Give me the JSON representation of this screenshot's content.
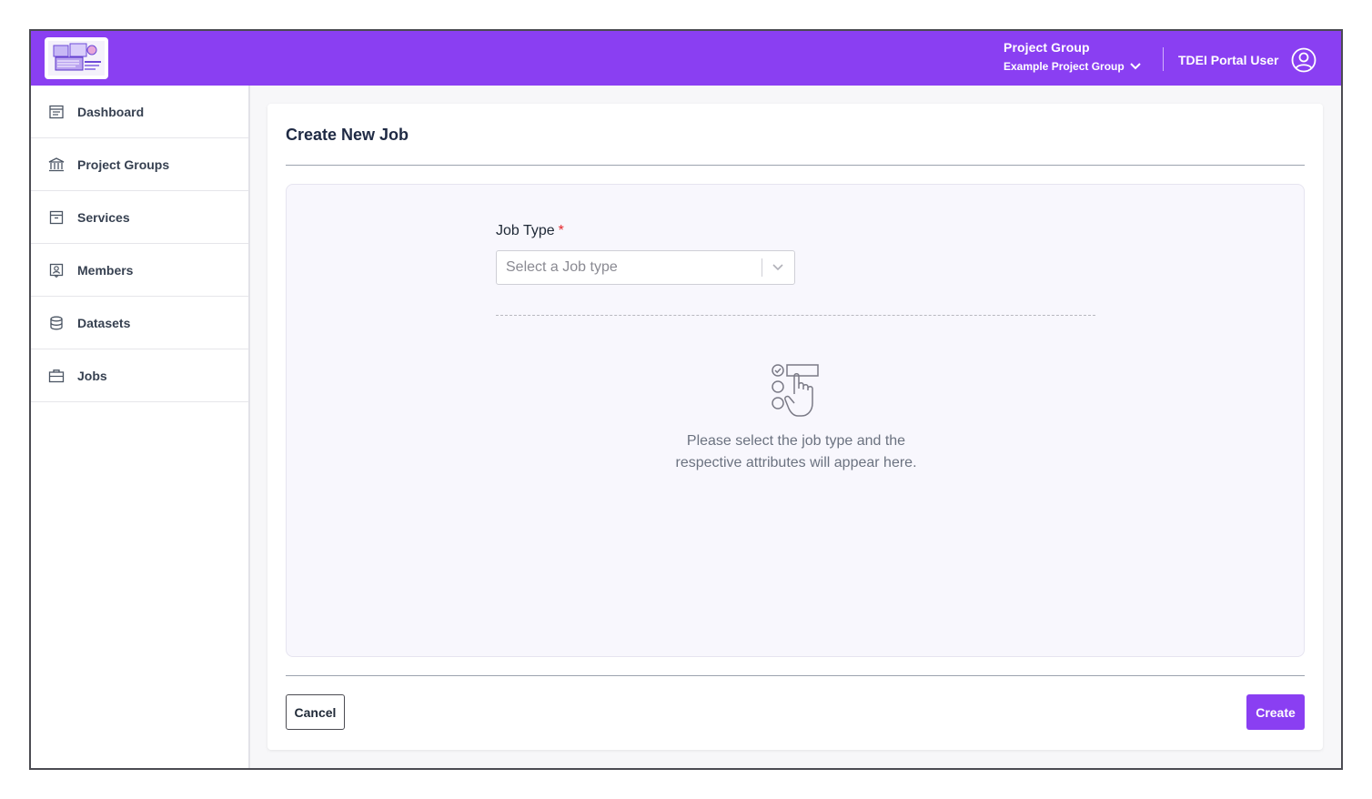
{
  "header": {
    "logo_icon": "portal-logo-illustration",
    "project_group_label": "Project Group",
    "project_group_value": "Example Project Group",
    "user_name": "TDEI Portal User",
    "accent_color": "#8a3ff2"
  },
  "sidebar": {
    "items": [
      {
        "label": "Dashboard",
        "icon": "dashboard-icon"
      },
      {
        "label": "Project Groups",
        "icon": "bank-icon"
      },
      {
        "label": "Services",
        "icon": "archive-box-icon"
      },
      {
        "label": "Members",
        "icon": "member-badge-icon"
      },
      {
        "label": "Datasets",
        "icon": "database-icon"
      },
      {
        "label": "Jobs",
        "icon": "briefcase-icon"
      }
    ]
  },
  "main": {
    "title": "Create New Job",
    "job_type_label": "Job Type",
    "required_marker": "*",
    "job_type_placeholder": "Select a Job type",
    "empty_state_line1": "Please select the job type and the",
    "empty_state_line2": "respective attributes will appear here.",
    "empty_state_icon": "select-option-hand-icon",
    "cancel_label": "Cancel",
    "create_label": "Create"
  }
}
